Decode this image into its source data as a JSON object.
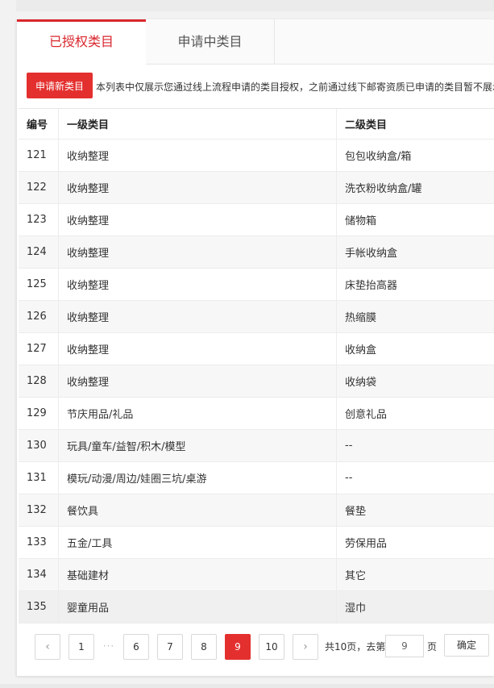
{
  "tabs": [
    {
      "label": "已授权类目"
    },
    {
      "label": "申请中类目"
    }
  ],
  "notice": {
    "apply_button": "申请新类目",
    "text": "本列表中仅展示您通过线上流程申请的类目授权，之前通过线下邮寄资质已申请的类目暂不展示"
  },
  "table": {
    "headers": [
      "编号",
      "一级类目",
      "二级类目"
    ],
    "rows": [
      [
        "121",
        "收纳整理",
        "包包收纳盒/箱"
      ],
      [
        "122",
        "收纳整理",
        "洗衣粉收纳盒/罐"
      ],
      [
        "123",
        "收纳整理",
        "储物箱"
      ],
      [
        "124",
        "收纳整理",
        "手帐收纳盒"
      ],
      [
        "125",
        "收纳整理",
        "床垫抬高器"
      ],
      [
        "126",
        "收纳整理",
        "热缩膜"
      ],
      [
        "127",
        "收纳整理",
        "收纳盒"
      ],
      [
        "128",
        "收纳整理",
        "收纳袋"
      ],
      [
        "129",
        "节庆用品/礼品",
        "创意礼品"
      ],
      [
        "130",
        "玩具/童车/益智/积木/模型",
        "--"
      ],
      [
        "131",
        "模玩/动漫/周边/娃圈三坑/桌游",
        "--"
      ],
      [
        "132",
        "餐饮具",
        "餐垫"
      ],
      [
        "133",
        "五金/工具",
        "劳保用品"
      ],
      [
        "134",
        "基础建材",
        "其它"
      ],
      [
        "135",
        "婴童用品",
        "湿巾"
      ]
    ]
  },
  "pagination": {
    "prev_icon": "‹",
    "next_icon": "›",
    "first": "1",
    "ellipsis": "···",
    "pages": [
      "6",
      "7",
      "8",
      "9",
      "10"
    ],
    "current": "9",
    "total_text": "共10页，去第",
    "goto_value": "9",
    "page_suffix": "页",
    "confirm": "确定"
  },
  "colors": {
    "accent": "#e3302f",
    "tab_active": "#d9272e"
  }
}
